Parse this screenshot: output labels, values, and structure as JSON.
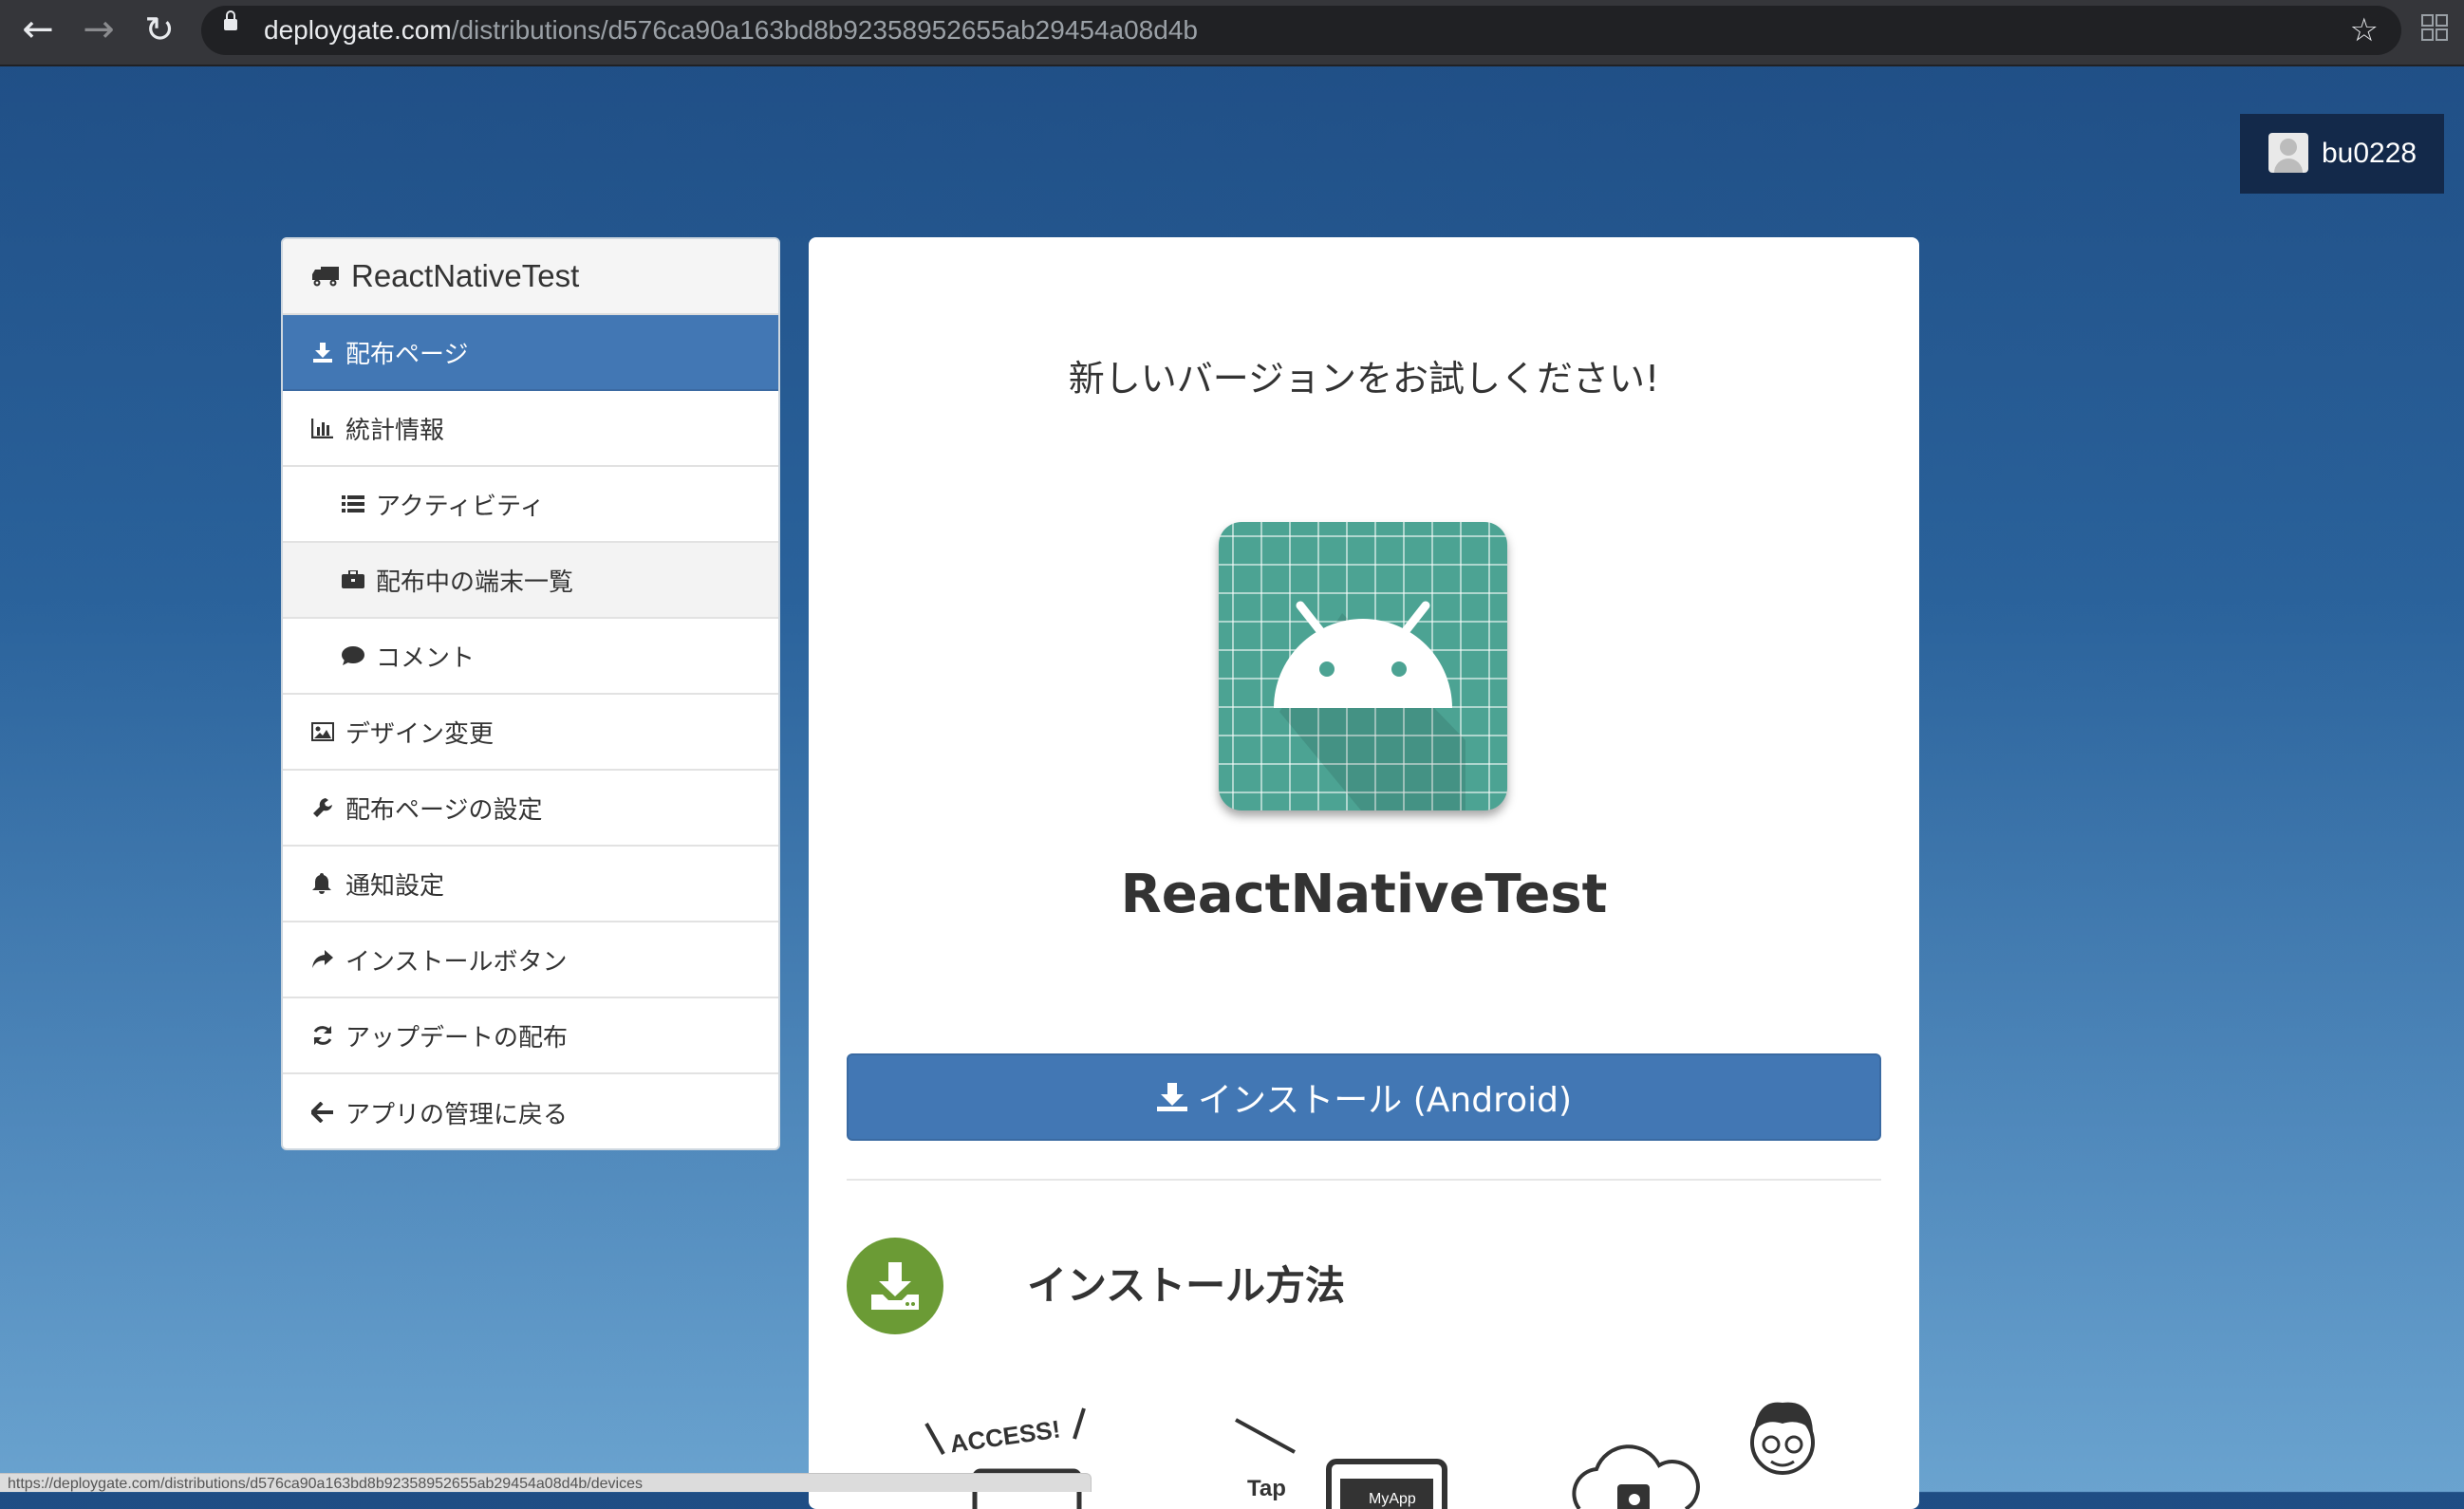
{
  "browser": {
    "url_host": "deploygate.com",
    "url_path": "/distributions/d576ca90a163bd8b92358952655ab29454a08d4b",
    "back_icon": "←",
    "forward_icon": "→",
    "reload_icon": "↻",
    "star_icon": "☆",
    "status_text": "https://deploygate.com/distributions/d576ca90a163bd8b92358952655ab29454a08d4b/devices"
  },
  "user": {
    "name": "bu0228"
  },
  "sidebar": {
    "title": "ReactNativeTest",
    "items": [
      {
        "label": "配布ページ",
        "icon": "download-icon"
      },
      {
        "label": "統計情報",
        "icon": "bar-chart-icon"
      },
      {
        "label": "アクティビティ",
        "icon": "list-icon"
      },
      {
        "label": "配布中の端末一覧",
        "icon": "briefcase-icon"
      },
      {
        "label": "コメント",
        "icon": "comment-icon"
      },
      {
        "label": "デザイン変更",
        "icon": "picture-icon"
      },
      {
        "label": "配布ページの設定",
        "icon": "wrench-icon"
      },
      {
        "label": "通知設定",
        "icon": "bell-icon"
      },
      {
        "label": "インストールボタン",
        "icon": "share-icon"
      },
      {
        "label": "アップデートの配布",
        "icon": "refresh-icon"
      },
      {
        "label": "アプリの管理に戻る",
        "icon": "arrow-left-icon"
      }
    ]
  },
  "main": {
    "tagline": "新しいバージョンをお試しください!",
    "app_name": "ReactNativeTest",
    "install_button": "インストール (Android)",
    "howto_title": "インストール方法",
    "illustration": {
      "access_text": "ACCESS!",
      "tap_text": "Tap",
      "myapp_text": "MyApp"
    }
  },
  "colors": {
    "accent": "#4277b4",
    "howto_green": "#6b9b35",
    "app_icon_teal": "#4ca393",
    "user_badge": "#13294a"
  }
}
